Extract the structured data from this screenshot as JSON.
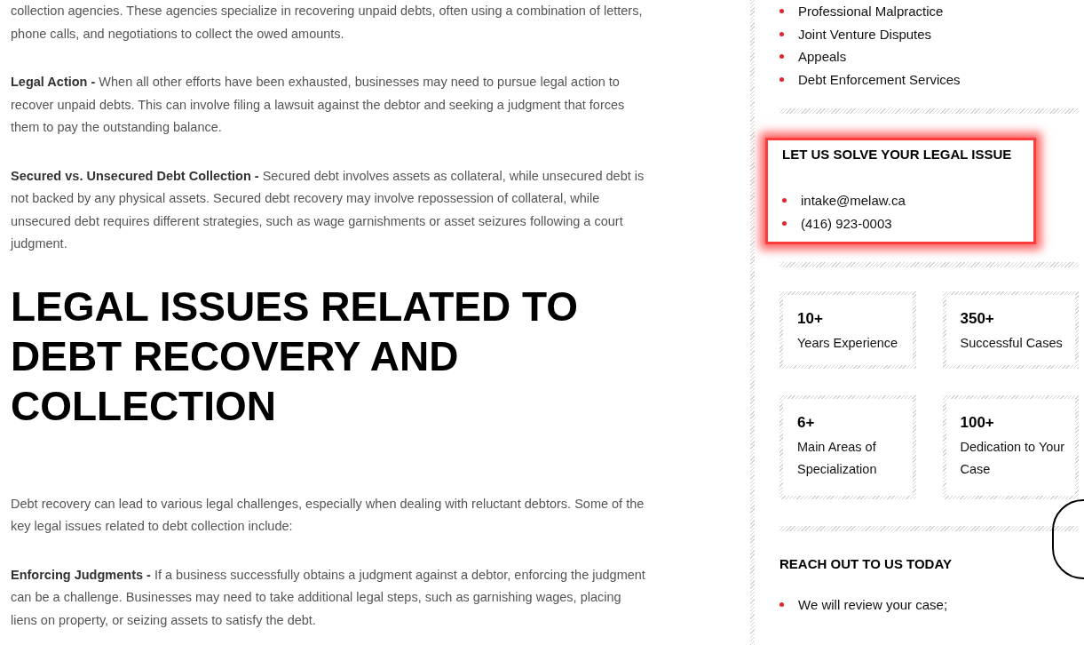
{
  "article": {
    "intro_paragraphs": [
      "collection agencies. These agencies specialize in recovering unpaid debts, often using a combination of letters, phone calls, and negotiations to collect the owed amounts.",
      "**Legal Action -** When all other efforts have been exhausted, businesses may need to pursue legal action to recover unpaid debts. This can involve filing a lawsuit against the debtor and seeking a judgment that forces them to pay the outstanding balance.",
      "**Secured vs. Unsecured Debt Collection -** Secured debt involves assets as collateral, while unsecured debt is not backed by any physical assets. Secured debt recovery may involve repossession of collateral, while unsecured debt requires different strategies, such as wage garnishments or asset seizures following a court judgment."
    ],
    "heading": "LEGAL ISSUES RELATED TO DEBT RECOVERY AND COLLECTION",
    "paragraphs": [
      "Debt recovery can lead to various legal challenges, especially when dealing with reluctant debtors. Some of the key legal issues related to debt collection include:",
      "**Enforcing Judgments -** If a business successfully obtains a judgment against a debtor, enforcing the judgment can be a challenge. Businesses may need to take additional legal steps, such as garnishing wages, placing liens on property, or seizing assets to satisfy the debt."
    ]
  },
  "sidebar": {
    "practice_areas": [
      "Professional Malpractice",
      "Joint Venture Disputes",
      "Appeals",
      "Debt Enforcement Services"
    ],
    "contact": {
      "title": "LET US SOLVE YOUR LEGAL ISSUE",
      "highlighted": true,
      "items": [
        "intake@melaw.ca",
        "(416) 923-0003"
      ]
    },
    "stats": [
      {
        "value": "10+",
        "label": "Years Experience"
      },
      {
        "value": "350+",
        "label": "Successful Cases"
      },
      {
        "value": "6+",
        "label": "Main Areas of Specialization"
      },
      {
        "value": "100+",
        "label": "Dedication to Your Case"
      }
    ],
    "reach_out": {
      "title": "REACH OUT TO US TODAY",
      "items": [
        "We will review your case;"
      ]
    }
  }
}
